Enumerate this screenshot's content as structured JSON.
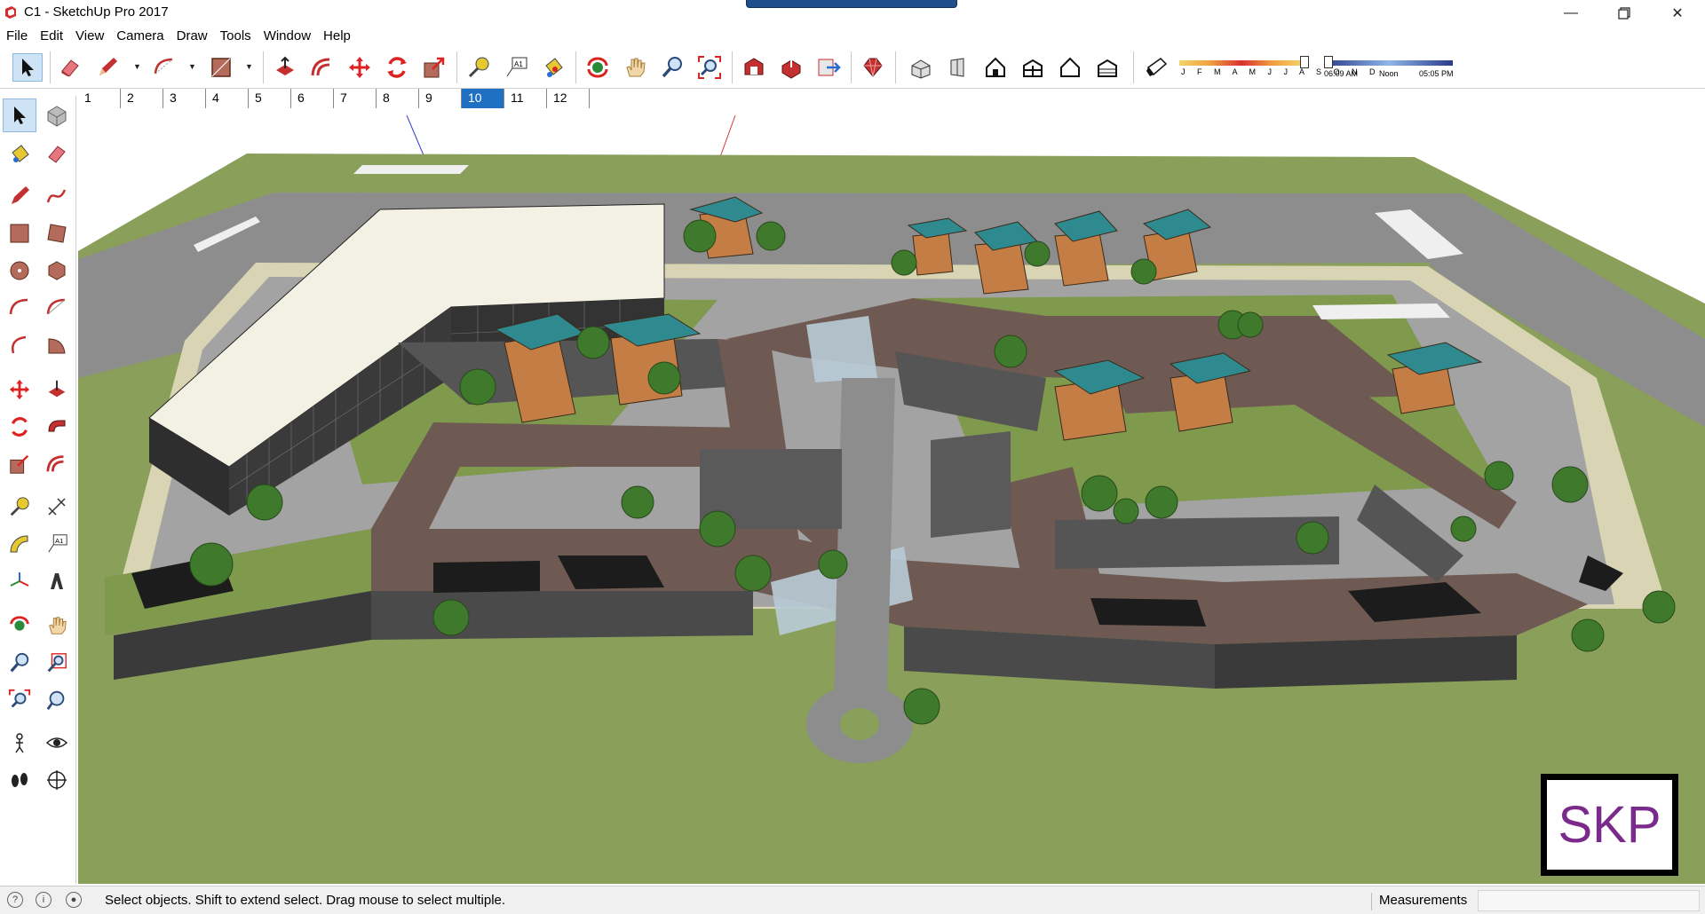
{
  "window": {
    "title": "C1 - SketchUp Pro 2017",
    "app_icon": "sketchup-icon",
    "controls": [
      "minimize-icon",
      "maximize-icon",
      "close-icon"
    ]
  },
  "menubar": {
    "items": [
      "File",
      "Edit",
      "View",
      "Camera",
      "Draw",
      "Tools",
      "Window",
      "Help"
    ]
  },
  "toolbar": {
    "tools": [
      "select-icon",
      "eraser-icon",
      "pencil-icon",
      "arc-icon",
      "rectangle-icon",
      "push-pull-icon",
      "offset-icon",
      "move-icon",
      "rotate-icon",
      "scale-icon",
      "tape-measure-icon",
      "text-icon",
      "paint-bucket-icon",
      "orbit-icon",
      "pan-icon",
      "zoom-icon",
      "zoom-extents-icon",
      "warehouse-icon",
      "share-model-icon",
      "send-to-layout-icon",
      "extension-warehouse-icon",
      "iso-view-icon",
      "top-view-icon",
      "front-view-icon",
      "right-view-icon",
      "back-view-icon",
      "left-view-icon",
      "shadows-toggle-icon"
    ],
    "shadow_months": "J F M A M J J A S O N D",
    "shadow_time_start": "06:09 AM",
    "shadow_time_noon": "Noon",
    "shadow_time_end": "05:05 PM"
  },
  "scene_tabs": {
    "items": [
      "1",
      "2",
      "3",
      "4",
      "5",
      "6",
      "7",
      "8",
      "9",
      "10",
      "11",
      "12"
    ],
    "active": "10"
  },
  "left_toolbar": {
    "tools": [
      "select-icon",
      "make-component-icon",
      "paint-bucket-icon",
      "eraser-icon",
      "line-icon",
      "freehand-icon",
      "rectangle-icon",
      "rotated-rectangle-icon",
      "circle-icon",
      "polygon-icon",
      "arc-icon",
      "pie-icon",
      "two-point-arc-icon",
      "three-point-arc-icon",
      "move-icon",
      "push-pull-icon",
      "rotate-icon",
      "follow-me-icon",
      "scale-icon",
      "offset-icon",
      "tape-measure-icon",
      "dimension-icon",
      "protractor-icon",
      "text-icon",
      "axes-icon",
      "3d-text-icon",
      "orbit-icon",
      "pan-icon",
      "zoom-icon",
      "zoom-window-icon",
      "zoom-extents-icon",
      "previous-view-icon",
      "position-camera-icon",
      "look-around-icon",
      "walk-icon",
      "section-plane-icon"
    ]
  },
  "status": {
    "text": "Select objects. Shift to extend select. Drag mouse to select multiple.",
    "measurements_label": "Measurements",
    "measurements_value": ""
  },
  "logo": {
    "text": "SKP"
  },
  "colors": {
    "grass": "#8aa05a",
    "road": "#8c8d8c",
    "sidewalk": "#d9d4b3",
    "roof": "#f3f1e3",
    "facade": "#2e2e2e",
    "walkway": "#6e5a52",
    "tower": "#c47e45",
    "tower_roof": "#2e8a8e",
    "tree": "#3f7a2c",
    "accent_tab": "#1f6fc3"
  }
}
